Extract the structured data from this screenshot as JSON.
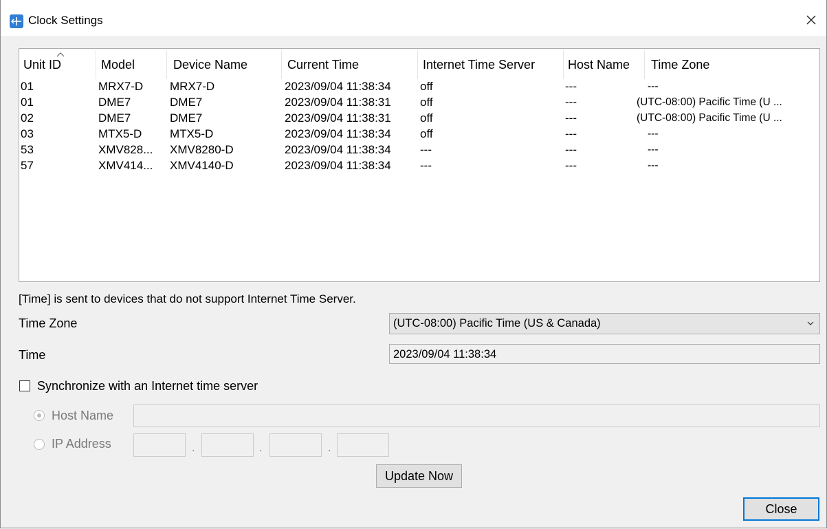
{
  "window": {
    "title": "Clock Settings",
    "close_glyph": "✕",
    "app_icon": "clock-settings-app-icon"
  },
  "table": {
    "headers": [
      "Unit ID",
      "Model",
      "Device Name",
      "Current Time",
      "Internet Time Server",
      "Host Name",
      "Time Zone"
    ],
    "sorted_column": "Unit ID",
    "rows": [
      [
        "01",
        "MRX7-D",
        "MRX7-D",
        "2023/09/04 11:38:34",
        "off",
        "---",
        "---"
      ],
      [
        "01",
        "DME7",
        "DME7",
        "2023/09/04 11:38:31",
        "off",
        "---",
        "(UTC-08:00) Pacific Time (U ..."
      ],
      [
        "02",
        "DME7",
        "DME7",
        "2023/09/04 11:38:31",
        "off",
        "---",
        "(UTC-08:00) Pacific Time (U ..."
      ],
      [
        "03",
        "MTX5-D",
        "MTX5-D",
        "2023/09/04 11:38:34",
        "off",
        "---",
        "---"
      ],
      [
        "53",
        "XMV828...",
        "XMV8280-D",
        "2023/09/04 11:38:34",
        "---",
        "---",
        "---"
      ],
      [
        "57",
        "XMV414...",
        "XMV4140-D",
        "2023/09/04 11:38:34",
        "---",
        "---",
        "---"
      ]
    ]
  },
  "form": {
    "note": "[Time] is sent to devices that do not support Internet Time Server.",
    "time_zone_label": "Time Zone",
    "time_zone_value": "(UTC-08:00) Pacific Time (US & Canada)",
    "time_label": "Time",
    "time_value": "2023/09/04 11:38:34",
    "sync_label": "Synchronize with an Internet time server",
    "sync_checked": false,
    "host_name_label": "Host Name",
    "host_name_value": "",
    "ip_address_label": "IP Address",
    "ip_octets": [
      "",
      "",
      "",
      ""
    ],
    "ip_separator": "."
  },
  "buttons": {
    "update_now": "Update Now",
    "close": "Close"
  },
  "colors": {
    "accent": "#0078d7",
    "app_icon": "#2f7fd6"
  }
}
